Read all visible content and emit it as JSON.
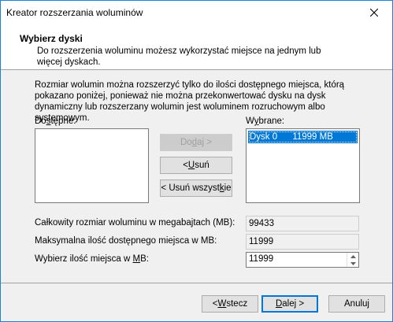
{
  "window": {
    "title": "Kreator rozszerzania woluminów"
  },
  "header": {
    "title": "Wybierz dyski",
    "description": "Do rozszerzenia woluminu możesz wykorzystać miejsce na jednym lub więcej dyskach."
  },
  "info_text": "Rozmiar wolumin można rozszerzyć tylko do ilości dostępnego miejsca, którą pokazano poniżej, ponieważ nie można przekonwertować dysku na dysk dynamiczny lub rozszerzany wolumin jest woluminem rozruchowym albo systemowym.",
  "available": {
    "label_pre": "Do",
    "label_u": "s",
    "label_post": "tępne:",
    "items": []
  },
  "selected": {
    "label_pre": "W",
    "label_u": "y",
    "label_post": "brane:",
    "items": [
      {
        "disk": "Dysk 0",
        "size": "11999 MB"
      }
    ]
  },
  "buttons": {
    "add": {
      "pre": "Do",
      "u": "d",
      "post": "aj >"
    },
    "remove": {
      "pre": "< ",
      "u": "U",
      "post": "suń"
    },
    "remove_all": {
      "pre": "< Usuń wszyst",
      "u": "k",
      "post": "ie"
    },
    "back": {
      "pre": "< ",
      "u": "W",
      "post": "stecz"
    },
    "next": {
      "pre": "",
      "u": "D",
      "post": "alej >"
    },
    "cancel": {
      "label": "Anuluj"
    }
  },
  "fields": {
    "total_size": {
      "label": "Całkowity rozmiar woluminu w megabajtach (MB):",
      "value": "99433"
    },
    "max_available": {
      "label": "Maksymalna ilość dostępnego miejsca w MB:",
      "value": "11999"
    },
    "select_amount": {
      "label_pre": "Wybierz ilość miejsca w ",
      "label_u": "M",
      "label_post": "B:",
      "value": "11999"
    }
  }
}
